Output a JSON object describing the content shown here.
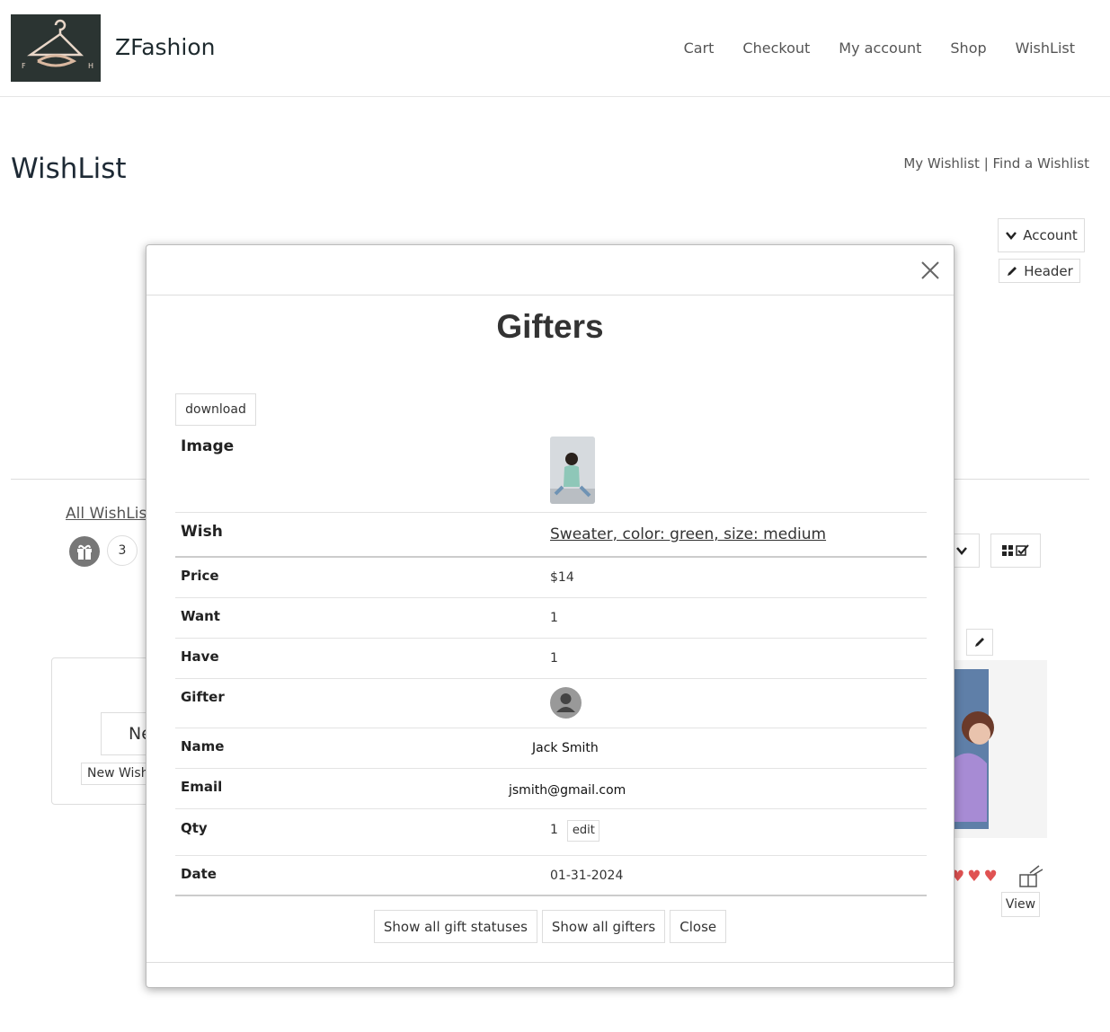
{
  "header": {
    "brand": "ZFashion",
    "logo_icon": "hanger-logo-icon",
    "nav": [
      "Cart",
      "Checkout",
      "My account",
      "Shop",
      "WishList"
    ]
  },
  "page": {
    "title": "WishList",
    "my_wishlist_link": "My Wishlist",
    "separator": " | ",
    "find_wishlist_link": "Find a Wishlist",
    "account_button": "Account",
    "header_button": "Header",
    "all_wishlists": "All WishList",
    "gift_count": "3",
    "new_big_label": "Ne",
    "new_small_label": "New Wishl",
    "view_button": "View"
  },
  "modal": {
    "title": "Gifters",
    "download_button": "download",
    "rows": {
      "image_label": "Image",
      "wish_label": "Wish",
      "wish_value": "Sweater, color: green, size: medium",
      "price_label": "Price",
      "price_value": "$14",
      "want_label": "Want",
      "want_value": "1",
      "have_label": "Have",
      "have_value": "1",
      "gifter_label": "Gifter",
      "name_label": "Name",
      "name_value": "Jack Smith",
      "email_label": "Email",
      "email_value": "jsmith@gmail.com",
      "qty_label": "Qty",
      "qty_value": "1",
      "qty_edit": "edit",
      "date_label": "Date",
      "date_value": "01-31-2024"
    },
    "actions": [
      "Show all gift statuses",
      "Show all gifters",
      "Close"
    ]
  },
  "colors": {
    "heart": "#e05252",
    "logo_bg": "#2b3432",
    "text_dark": "#1e2a35"
  }
}
